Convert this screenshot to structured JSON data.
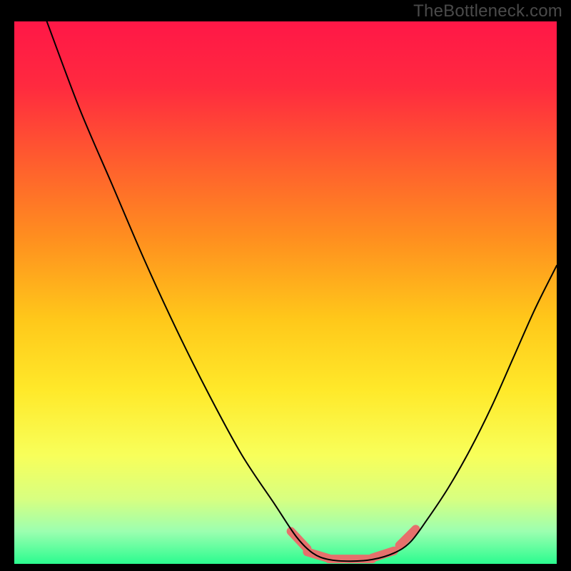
{
  "watermark": "TheBottleneck.com",
  "chart_data": {
    "type": "line",
    "title": "",
    "xlabel": "",
    "ylabel": "",
    "xlim": [
      0,
      100
    ],
    "ylim": [
      0,
      100
    ],
    "gradient_stops": [
      {
        "offset": 0.0,
        "color": "#ff1747"
      },
      {
        "offset": 0.12,
        "color": "#ff2a3f"
      },
      {
        "offset": 0.25,
        "color": "#ff5a2f"
      },
      {
        "offset": 0.4,
        "color": "#ff8f1f"
      },
      {
        "offset": 0.55,
        "color": "#ffc81a"
      },
      {
        "offset": 0.68,
        "color": "#ffe92a"
      },
      {
        "offset": 0.8,
        "color": "#f8ff5a"
      },
      {
        "offset": 0.88,
        "color": "#d8ff80"
      },
      {
        "offset": 0.94,
        "color": "#9cffb0"
      },
      {
        "offset": 1.0,
        "color": "#2bfc8f"
      }
    ],
    "series": [
      {
        "name": "curve",
        "color": "#000000",
        "points": [
          {
            "x": 6,
            "y": 100
          },
          {
            "x": 12,
            "y": 84
          },
          {
            "x": 18,
            "y": 70
          },
          {
            "x": 24,
            "y": 56
          },
          {
            "x": 30,
            "y": 43
          },
          {
            "x": 36,
            "y": 31
          },
          {
            "x": 42,
            "y": 20
          },
          {
            "x": 48,
            "y": 11
          },
          {
            "x": 52,
            "y": 5
          },
          {
            "x": 55,
            "y": 2
          },
          {
            "x": 58,
            "y": 0.8
          },
          {
            "x": 62,
            "y": 0.5
          },
          {
            "x": 66,
            "y": 0.8
          },
          {
            "x": 70,
            "y": 2
          },
          {
            "x": 73,
            "y": 4
          },
          {
            "x": 76,
            "y": 8
          },
          {
            "x": 80,
            "y": 14
          },
          {
            "x": 84,
            "y": 21
          },
          {
            "x": 88,
            "y": 29
          },
          {
            "x": 92,
            "y": 38
          },
          {
            "x": 96,
            "y": 47
          },
          {
            "x": 100,
            "y": 55
          }
        ]
      }
    ],
    "highlight_band": {
      "color": "#e6706c",
      "segments": [
        {
          "x1": 51,
          "y1": 6.0,
          "x2": 54,
          "y2": 2.8
        },
        {
          "x1": 54,
          "y1": 2.2,
          "x2": 58,
          "y2": 1.0
        },
        {
          "x1": 58,
          "y1": 0.9,
          "x2": 66,
          "y2": 0.9
        },
        {
          "x1": 66,
          "y1": 1.1,
          "x2": 70,
          "y2": 2.4
        },
        {
          "x1": 71,
          "y1": 3.4,
          "x2": 74,
          "y2": 6.4
        }
      ]
    }
  }
}
